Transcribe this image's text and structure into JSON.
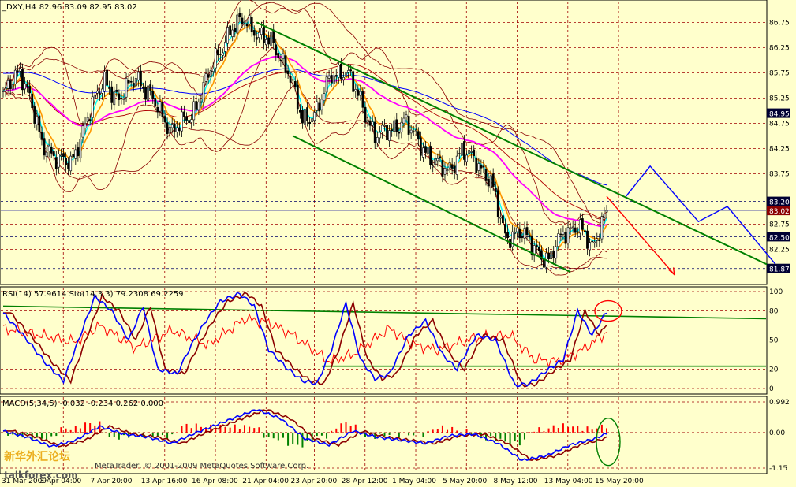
{
  "window_title": "_DXY,H4",
  "ohlc_readout": "82.96 83.09 82.95 83.02",
  "watermark": {
    "logo_text": "新华外汇论坛",
    "brand": "MetaTrader, © 2001-2009 MetaQuotes Software Corp.",
    "site": "talkforex.com"
  },
  "colors": {
    "background": "#FFFFCC",
    "grid": "#A00000",
    "panel_border": "#000000",
    "bull_candle": "#FFFFFF",
    "bear_candle": "#000000",
    "channel": "#008000",
    "forecast_blue": "#0000FF",
    "forecast_red": "#FF0000",
    "ma_slow_magenta": "#FF00FF",
    "ma_long_blue": "#0000FF",
    "ma_fast_orange": "#FF9900",
    "ma_fast_cyan": "#00FFFF",
    "bollinger": "#8B0000",
    "rsi_line": "#FF0000",
    "stoch_main": "#0000FF",
    "stoch_signal": "#8B0000",
    "macd_pos": "#FF0000",
    "macd_neg": "#008000"
  },
  "chart_data": [
    {
      "type": "candlestick",
      "panel": "price",
      "title": "_DXY,H4",
      "ylim": [
        81.6,
        87.1
      ],
      "y_ticks": [
        86.75,
        86.25,
        85.75,
        85.25,
        84.75,
        84.25,
        83.75,
        82.75,
        82.25
      ],
      "price_tags": [
        {
          "label": "84.95",
          "style": "dark"
        },
        {
          "label": "83.20",
          "style": "dark"
        },
        {
          "label": "83.02",
          "style": "red"
        },
        {
          "label": "82.50",
          "style": "dark"
        },
        {
          "label": "81.87",
          "style": "dark"
        }
      ],
      "x_labels": [
        "31 Mar 2009",
        "3 Apr 04:00",
        "7 Apr 20:00",
        "13 Apr 16:00",
        "16 Apr 08:00",
        "21 Apr 04:00",
        "23 Apr 20:00",
        "28 Apr 12:00",
        "1 May 04:00",
        "5 May 20:00",
        "8 May 12:00",
        "13 May 04:00",
        "15 May 20:00"
      ],
      "close_path": [
        {
          "bar": 0,
          "price": 85.3
        },
        {
          "bar": 7,
          "price": 85.8
        },
        {
          "bar": 11,
          "price": 85.3
        },
        {
          "bar": 16,
          "price": 84.3
        },
        {
          "bar": 22,
          "price": 84.1
        },
        {
          "bar": 28,
          "price": 83.9
        },
        {
          "bar": 35,
          "price": 84.9
        },
        {
          "bar": 42,
          "price": 85.6
        },
        {
          "bar": 48,
          "price": 85.2
        },
        {
          "bar": 55,
          "price": 85.7
        },
        {
          "bar": 62,
          "price": 85.2
        },
        {
          "bar": 70,
          "price": 84.6
        },
        {
          "bar": 78,
          "price": 84.9
        },
        {
          "bar": 86,
          "price": 85.8
        },
        {
          "bar": 94,
          "price": 86.6
        },
        {
          "bar": 100,
          "price": 86.8
        },
        {
          "bar": 106,
          "price": 86.5
        },
        {
          "bar": 112,
          "price": 86.3
        },
        {
          "bar": 118,
          "price": 85.8
        },
        {
          "bar": 124,
          "price": 84.8
        },
        {
          "bar": 130,
          "price": 85.0
        },
        {
          "bar": 136,
          "price": 85.7
        },
        {
          "bar": 142,
          "price": 85.8
        },
        {
          "bar": 148,
          "price": 85.2
        },
        {
          "bar": 154,
          "price": 84.5
        },
        {
          "bar": 160,
          "price": 84.6
        },
        {
          "bar": 166,
          "price": 84.8
        },
        {
          "bar": 172,
          "price": 84.4
        },
        {
          "bar": 178,
          "price": 84.0
        },
        {
          "bar": 184,
          "price": 83.8
        },
        {
          "bar": 190,
          "price": 84.2
        },
        {
          "bar": 196,
          "price": 84.0
        },
        {
          "bar": 202,
          "price": 83.6
        },
        {
          "bar": 208,
          "price": 82.5
        },
        {
          "bar": 214,
          "price": 82.6
        },
        {
          "bar": 220,
          "price": 82.3
        },
        {
          "bar": 226,
          "price": 82.0
        },
        {
          "bar": 232,
          "price": 82.6
        },
        {
          "bar": 238,
          "price": 82.7
        },
        {
          "bar": 244,
          "price": 82.3
        },
        {
          "bar": 250,
          "price": 83.02
        }
      ],
      "overlays": [
        {
          "name": "channel_upper",
          "from": {
            "bar": 105,
            "price": 86.75
          },
          "to": {
            "bar": 320,
            "price": 81.87
          }
        },
        {
          "name": "channel_lower",
          "from": {
            "bar": 120,
            "price": 84.5
          },
          "to": {
            "bar": 235,
            "price": 81.8
          }
        },
        {
          "name": "forecast_blue",
          "points": [
            {
              "bar": 258,
              "price": 83.3
            },
            {
              "bar": 268,
              "price": 83.9
            },
            {
              "bar": 288,
              "price": 82.8
            },
            {
              "bar": 300,
              "price": 83.1
            },
            {
              "bar": 320,
              "price": 81.95
            }
          ]
        },
        {
          "name": "forecast_red",
          "points": [
            {
              "bar": 250,
              "price": 83.3
            },
            {
              "bar": 278,
              "price": 81.75
            }
          ]
        }
      ]
    },
    {
      "type": "line",
      "panel": "oscillator",
      "title": "RSI(14) 57.9614 Sto(14,3,3) 79.2308 69.2259",
      "ylim": [
        0,
        100
      ],
      "y_ticks": [
        100,
        80,
        50,
        20,
        0
      ],
      "series": [
        {
          "name": "RSI(14)",
          "last": 57.9614,
          "points": [
            [
              0,
              62
            ],
            [
              15,
              55
            ],
            [
              30,
              48
            ],
            [
              40,
              65
            ],
            [
              55,
              42
            ],
            [
              70,
              60
            ],
            [
              85,
              45
            ],
            [
              100,
              72
            ],
            [
              110,
              68
            ],
            [
              120,
              55
            ],
            [
              135,
              28
            ],
            [
              145,
              35
            ],
            [
              160,
              62
            ],
            [
              170,
              45
            ],
            [
              180,
              40
            ],
            [
              195,
              52
            ],
            [
              210,
              55
            ],
            [
              220,
              30
            ],
            [
              230,
              28
            ],
            [
              240,
              40
            ],
            [
              250,
              57.96
            ]
          ]
        },
        {
          "name": "Sto(14,3,3)",
          "last": 79.2308,
          "points": [
            [
              0,
              78
            ],
            [
              10,
              50
            ],
            [
              18,
              25
            ],
            [
              25,
              8
            ],
            [
              32,
              55
            ],
            [
              38,
              95
            ],
            [
              45,
              80
            ],
            [
              52,
              50
            ],
            [
              58,
              85
            ],
            [
              64,
              20
            ],
            [
              72,
              15
            ],
            [
              78,
              45
            ],
            [
              84,
              70
            ],
            [
              90,
              90
            ],
            [
              98,
              98
            ],
            [
              104,
              85
            ],
            [
              110,
              40
            ],
            [
              118,
              20
            ],
            [
              124,
              8
            ],
            [
              130,
              5
            ],
            [
              136,
              40
            ],
            [
              142,
              88
            ],
            [
              148,
              30
            ],
            [
              154,
              10
            ],
            [
              160,
              15
            ],
            [
              168,
              55
            ],
            [
              175,
              70
            ],
            [
              182,
              35
            ],
            [
              188,
              20
            ],
            [
              196,
              55
            ],
            [
              204,
              50
            ],
            [
              212,
              3
            ],
            [
              218,
              5
            ],
            [
              226,
              20
            ],
            [
              232,
              30
            ],
            [
              238,
              80
            ],
            [
              244,
              55
            ],
            [
              250,
              79.23
            ]
          ]
        },
        {
          "name": "Signal",
          "last": 69.2259,
          "lag": 3
        }
      ]
    },
    {
      "type": "bar",
      "panel": "macd",
      "title": "MACD(5,34,5) -0.032 -0.234 0.262 0.000",
      "ylim": [
        -1.15,
        0.992
      ],
      "y_ticks": [
        0.992,
        0.0,
        -1.15
      ],
      "y_tick_labels": [
        "0.992",
        "0.00",
        "-1.15"
      ],
      "series": [
        {
          "name": "MACD",
          "last": -0.032,
          "points": [
            [
              0,
              0.05
            ],
            [
              10,
              -0.15
            ],
            [
              20,
              -0.45
            ],
            [
              30,
              -0.25
            ],
            [
              40,
              0.2
            ],
            [
              50,
              -0.05
            ],
            [
              60,
              -0.15
            ],
            [
              70,
              -0.35
            ],
            [
              80,
              0.0
            ],
            [
              95,
              0.45
            ],
            [
              105,
              0.75
            ],
            [
              115,
              0.45
            ],
            [
              125,
              -0.2
            ],
            [
              135,
              -0.4
            ],
            [
              145,
              0.05
            ],
            [
              155,
              -0.15
            ],
            [
              165,
              -0.25
            ],
            [
              175,
              -0.35
            ],
            [
              185,
              -0.1
            ],
            [
              195,
              -0.05
            ],
            [
              205,
              -0.35
            ],
            [
              215,
              -0.9
            ],
            [
              225,
              -0.75
            ],
            [
              235,
              -0.4
            ],
            [
              245,
              -0.2
            ],
            [
              250,
              -0.03
            ]
          ]
        },
        {
          "name": "Signal",
          "last": -0.234,
          "lag": 4
        },
        {
          "name": "Histogram",
          "last": 0.262
        }
      ]
    }
  ]
}
